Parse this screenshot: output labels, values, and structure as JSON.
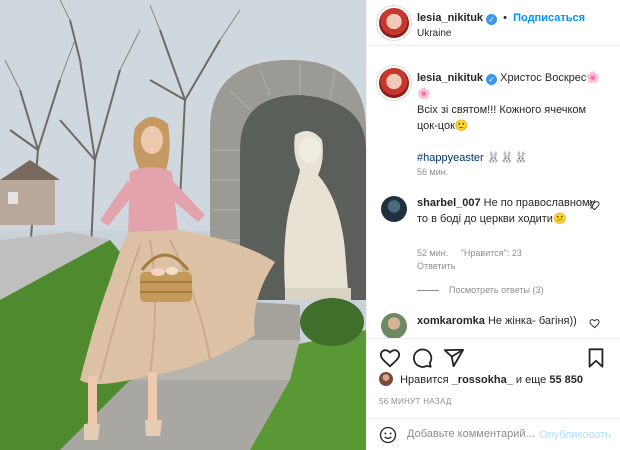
{
  "header": {
    "username": "lesia_nikituk",
    "follow_label": "Подписаться",
    "dot": "•",
    "location": "Ukraine"
  },
  "caption": {
    "username": "lesia_nikituk",
    "line1": "Христос Воскрес🌸",
    "line2": "🌸",
    "line3": "Всіх зі святом!!! Кожного ячечком",
    "line4": "цок-цок🙂",
    "hashtag": "#happyeaster",
    "bunnies": "🐰🐰🐰",
    "time": "56 мин."
  },
  "comments": [
    {
      "username": "sharbel_007",
      "text": "Не по православному то в боді до церкви ходити😕",
      "time": "52 мин.",
      "likes": "\"Нравится\": 23",
      "reply": "Ответить"
    },
    {
      "username": "xomkaromka",
      "text": "Не жінка- багіня))"
    }
  ],
  "view_replies": "Посмотреть ответы (3)",
  "likes": {
    "prefix": "Нравится",
    "user": "_rossokha_",
    "suffix": "и еще",
    "count": "55 850"
  },
  "posted_ago": "56 МИНУТ НАЗАД",
  "add_comment": {
    "placeholder": "Добавьте комментарий...",
    "publish_label": "Опубликовать"
  },
  "colors": {
    "accent": "#0095f6",
    "muted": "#8e8e8e",
    "text": "#262626"
  },
  "icons": [
    "heart-icon",
    "comment-icon",
    "share-icon",
    "bookmark-icon",
    "smiley-icon",
    "verified-icon"
  ]
}
